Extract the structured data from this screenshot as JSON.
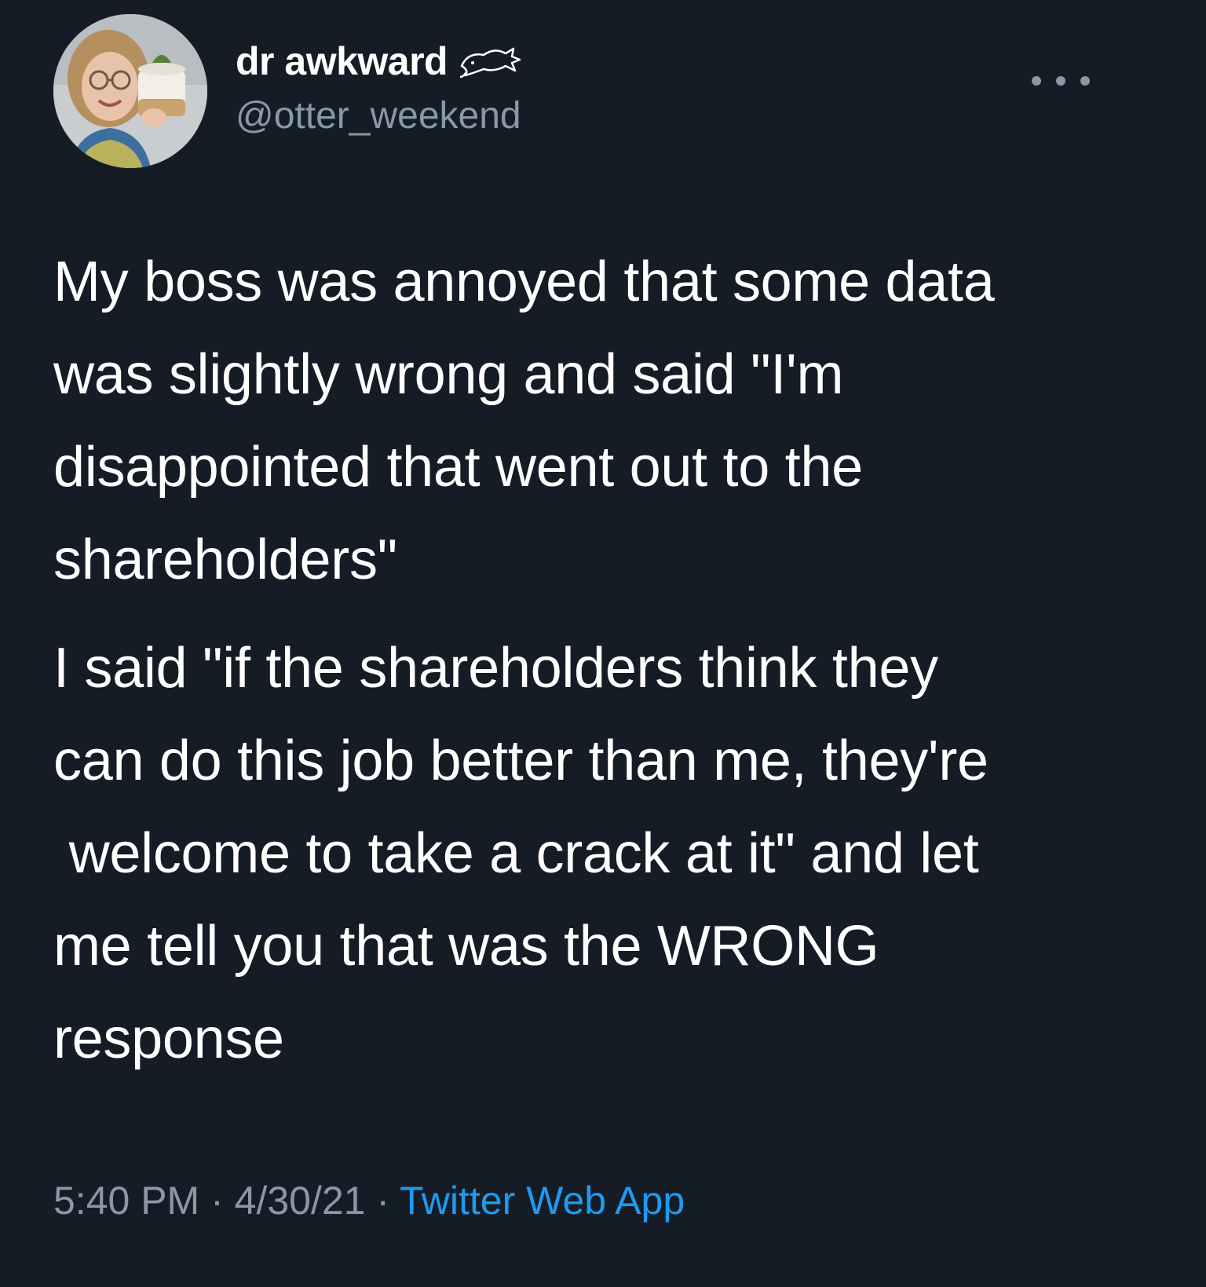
{
  "user": {
    "display_name": "dr awkward",
    "handle": "@otter_weekend",
    "badge_icon": "otter-icon"
  },
  "tweet": {
    "paragraph1": [
      "My boss was annoyed that some data",
      "was slightly wrong and said \"I'm",
      "disappointed that went out to the",
      "shareholders\""
    ],
    "paragraph2": [
      "I said \"if the shareholders think they",
      "can do this job better than me, they're",
      " welcome to take a crack at it\" and let",
      "me tell you that was the WRONG",
      "response"
    ]
  },
  "meta": {
    "time": "5:40 PM",
    "separator1": " · ",
    "date": "4/30/21",
    "separator2": " · ",
    "source": "Twitter Web App"
  },
  "colors": {
    "background": "#161c26",
    "text": "#ffffff",
    "muted": "#8899a6",
    "link": "#1d9bf0"
  }
}
